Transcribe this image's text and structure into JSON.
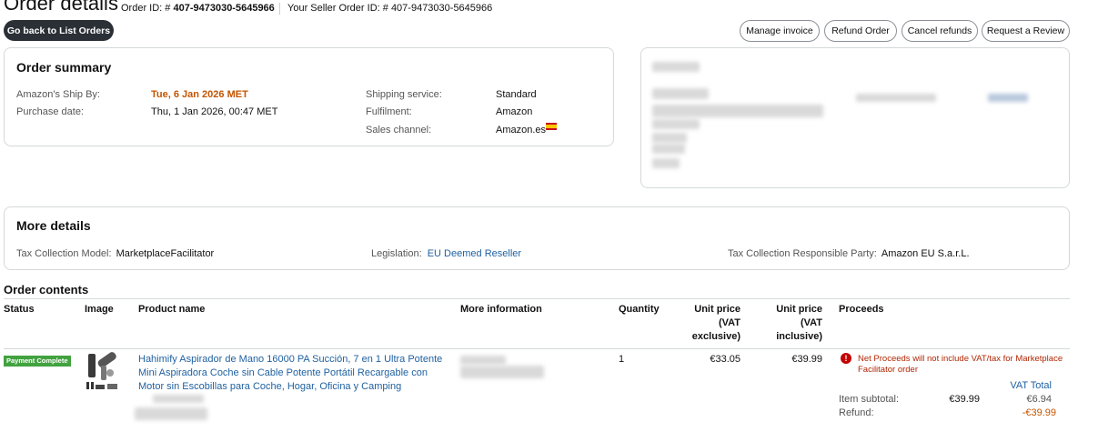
{
  "header": {
    "title": "Order details",
    "order_id_label": "Order ID: #",
    "order_id": "407-9473030-5645966",
    "seller_order_id_label": "Your Seller Order ID: #",
    "seller_order_id": "407-9473030-5645966"
  },
  "toolbar": {
    "back_label": "Go back to List Orders",
    "manage_invoice": "Manage invoice",
    "refund_order": "Refund Order",
    "cancel_refunds": "Cancel refunds",
    "request_review": "Request a Review"
  },
  "summary": {
    "title": "Order summary",
    "ship_by_label": "Amazon's Ship By:",
    "ship_by_value": "Tue, 6 Jan 2026 MET",
    "purchase_date_label": "Purchase date:",
    "purchase_date_value": "Thu, 1 Jan 2026, 00:47 MET",
    "shipping_service_label": "Shipping service:",
    "shipping_service_value": "Standard",
    "fulfilment_label": "Fulfilment:",
    "fulfilment_value": "Amazon",
    "sales_channel_label": "Sales channel:",
    "sales_channel_value": "Amazon.es"
  },
  "more_details": {
    "title": "More details",
    "tax_model_label": "Tax Collection Model:",
    "tax_model_value": "MarketplaceFacilitator",
    "legislation_label": "Legislation:",
    "legislation_value": "EU Deemed Reseller",
    "responsible_label": "Tax Collection Responsible Party:",
    "responsible_value": "Amazon EU S.a.r.L."
  },
  "contents": {
    "title": "Order contents",
    "columns": {
      "status": "Status",
      "image": "Image",
      "product_name": "Product name",
      "more_info": "More information",
      "quantity": "Quantity",
      "unit_price_ex_1": "Unit price",
      "unit_price_ex_2": "(VAT",
      "unit_price_ex_3": "exclusive)",
      "unit_price_in_1": "Unit price",
      "unit_price_in_2": "(VAT",
      "unit_price_in_3": "inclusive)",
      "proceeds": "Proceeds"
    },
    "row": {
      "status": "Payment Complete",
      "product_line1": "Hahimify Aspirador de Mano 16000 PA Succión, 7 en 1 Ultra Potente",
      "product_line2": "Mini Aspiradora Coche sin Cable Potente Portátil Recargable con",
      "product_line3": "Motor sin Escobillas para Coche, Hogar, Oficina y Camping",
      "quantity": "1",
      "unit_price_ex": "€33.05",
      "unit_price_in": "€39.99",
      "warning_line1": "Net Proceeds will not include VAT/tax for Marketplace",
      "warning_line2": "Facilitator order",
      "vat_total_label": "VAT Total",
      "item_subtotal_label": "Item subtotal:",
      "item_subtotal_value": "€39.99",
      "item_subtotal_vat": "€6.94",
      "refund_label": "Refund:",
      "refund_vat": "-€39.99"
    }
  },
  "colors": {
    "accent_orange": "#c45500",
    "link_blue": "#2162a1",
    "badge_green": "#41a23f",
    "warning_red": "#b12704",
    "dark_button": "#2b2f36"
  }
}
